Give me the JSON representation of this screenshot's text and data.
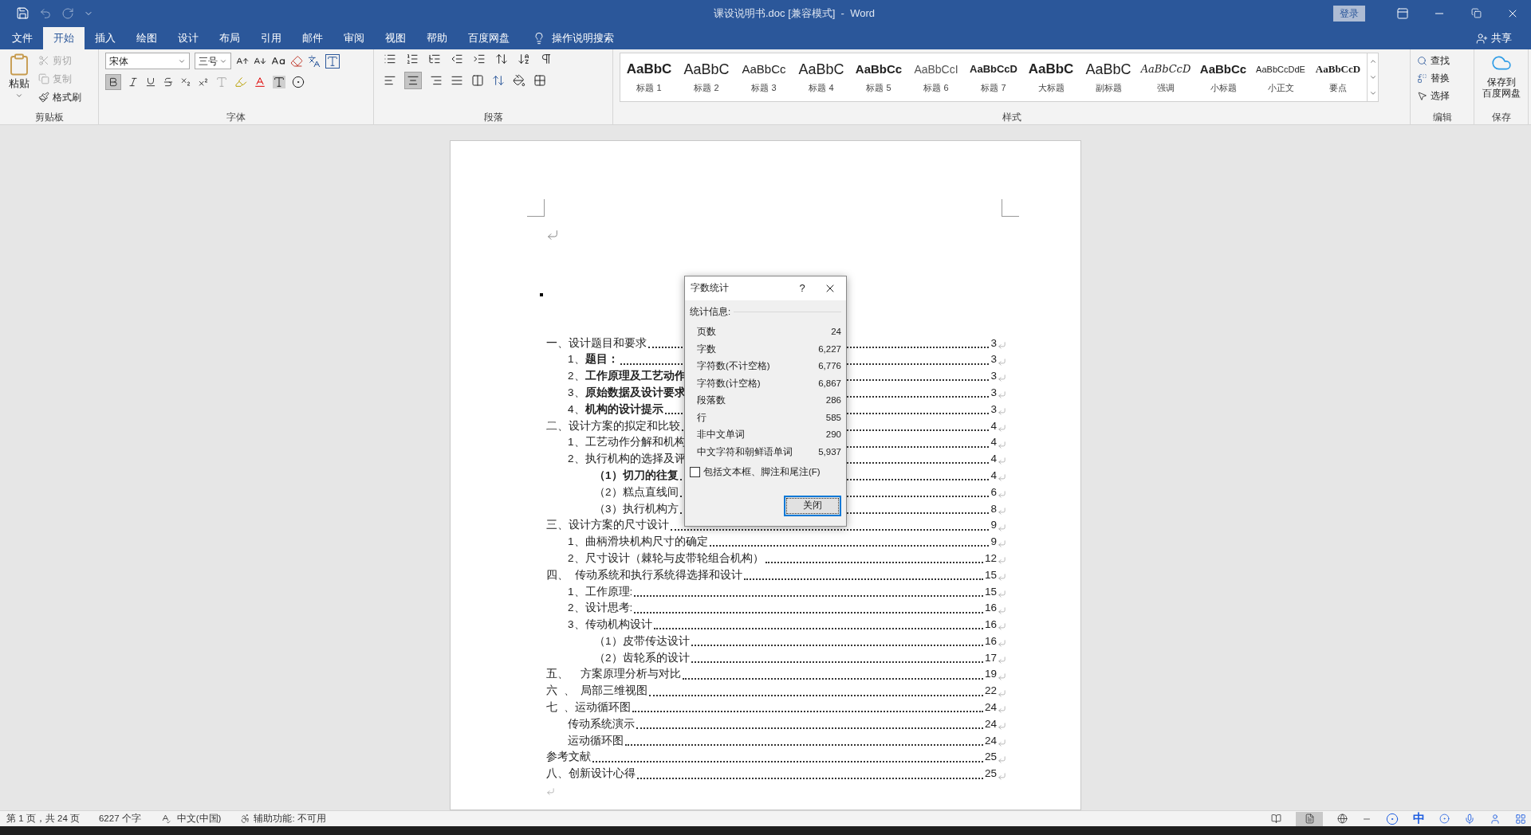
{
  "window": {
    "title": "课设说明书.doc [兼容模式]  -  Word",
    "sign_in": "登录"
  },
  "tabs": [
    {
      "label": "文件",
      "selected": false
    },
    {
      "label": "开始",
      "selected": true
    },
    {
      "label": "插入",
      "selected": false
    },
    {
      "label": "绘图",
      "selected": false
    },
    {
      "label": "设计",
      "selected": false
    },
    {
      "label": "布局",
      "selected": false
    },
    {
      "label": "引用",
      "selected": false
    },
    {
      "label": "邮件",
      "selected": false
    },
    {
      "label": "审阅",
      "selected": false
    },
    {
      "label": "视图",
      "selected": false
    },
    {
      "label": "帮助",
      "selected": false
    },
    {
      "label": "百度网盘",
      "selected": false
    }
  ],
  "tell_me": "操作说明搜索",
  "share": "共享",
  "clipboard": {
    "label": "剪贴板",
    "paste": "粘贴",
    "cut": {
      "label": "剪切",
      "disabled": true
    },
    "copy": {
      "label": "复制",
      "disabled": true
    },
    "format_painter": {
      "label": "格式刷",
      "disabled": false
    }
  },
  "font": {
    "label": "字体",
    "name": "宋体",
    "size": "三号",
    "bold": true
  },
  "paragraph": {
    "label": "段落",
    "align_center": true
  },
  "styles": {
    "label": "样式",
    "items": [
      {
        "preview": "AaBbC",
        "label": "标题 1",
        "kind": "heavy"
      },
      {
        "preview": "AaBbC",
        "label": "标题 2",
        "kind": "large"
      },
      {
        "preview": "AaBbCc",
        "label": "标题 3",
        "kind": "normal"
      },
      {
        "preview": "AaBbC",
        "label": "标题 4",
        "kind": "large"
      },
      {
        "preview": "AaBbCc",
        "label": "标题 5",
        "kind": "bold"
      },
      {
        "preview": "AaBbCcI",
        "label": "标题 6",
        "kind": "light"
      },
      {
        "preview": "AaBbCcD",
        "label": "标题 7",
        "kind": "bold-small"
      },
      {
        "preview": "AaBbC",
        "label": "大标题",
        "kind": "heavy"
      },
      {
        "preview": "AaBbC",
        "label": "副标题",
        "kind": "large"
      },
      {
        "preview": "AaBbCcD",
        "label": "强调",
        "kind": "italic"
      },
      {
        "preview": "AaBbCc",
        "label": "小标题",
        "kind": "bold"
      },
      {
        "preview": "AaBbCcDdE",
        "label": "小正文",
        "kind": "tiny"
      },
      {
        "preview": "AaBbCcD",
        "label": "要点",
        "kind": "serif-bold"
      }
    ]
  },
  "editing": {
    "label": "编辑",
    "find": "查找",
    "replace": "替换",
    "select": "选择"
  },
  "save": {
    "label": "保存",
    "button": [
      "保存到",
      "百度网盘"
    ]
  },
  "toc": [
    {
      "text": "一、设计题目和要求",
      "page": "3",
      "bold": false,
      "children": [
        {
          "text": "1、**题目：**",
          "page": "3",
          "bold": false
        },
        {
          "text": "2、**工作原理及工艺动作**",
          "page": "3",
          "bold": false
        },
        {
          "text": "3、**原始数据及设计要求**",
          "page": "3",
          "bold": false
        },
        {
          "text": "4、**机构的设计提示**",
          "page": "3",
          "bold": false
        }
      ]
    },
    {
      "text": "二、设计方案的拟定和比较",
      "page": "4",
      "bold": false,
      "children": [
        {
          "text": "1、工艺动作分解和机构",
          "page": "4",
          "bold": false
        },
        {
          "text": "2、执行机构的选择及评",
          "page": "4",
          "bold": false,
          "children": [
            {
              "text": "（1）切刀的往复",
              "page": "4",
              "bold": true
            },
            {
              "text": "（2）糕点直线间",
              "page": "6",
              "bold": false
            },
            {
              "text": "（3）执行机构方",
              "page": "8",
              "bold": false
            }
          ]
        }
      ]
    },
    {
      "text": "三、设计方案的尺寸设计",
      "page": "9",
      "bold": false,
      "children": [
        {
          "text": "1、曲柄滑块机构尺寸的确定",
          "page": "9",
          "bold": false
        },
        {
          "text": "2、尺寸设计（棘轮与皮带轮组合机构）",
          "page": "12",
          "bold": false
        }
      ]
    },
    {
      "text": "四、  传动系统和执行系统得选择和设计",
      "page": "15",
      "bold": false,
      "children": [
        {
          "text": "1、工作原理:",
          "page": "15",
          "bold": false
        },
        {
          "text": "2、设计思考:",
          "page": "16",
          "bold": false
        },
        {
          "text": "3、传动机构设计",
          "page": "16",
          "bold": false,
          "children": [
            {
              "text": "（1）皮带传达设计",
              "page": "16",
              "bold": false
            },
            {
              "text": "（2）齿轮系的设计",
              "page": "17",
              "bold": false
            }
          ]
        }
      ]
    },
    {
      "text": "五、    方案原理分析与对比",
      "page": "19",
      "bold": false
    },
    {
      "text": "六  、  局部三维视图",
      "page": "22",
      "bold": false
    },
    {
      "text": "七  、运动循环图",
      "page": "24",
      "bold": false,
      "children": [
        {
          "text": "传动系统演示",
          "page": "24",
          "bold": false
        },
        {
          "text": "运动循环图",
          "page": "24",
          "bold": false
        }
      ]
    },
    {
      "text": "参考文献",
      "page": "25",
      "bold": false
    },
    {
      "text": "八、创新设计心得",
      "page": "25",
      "bold": false
    }
  ],
  "dialog": {
    "title": "字数统计",
    "help": "?",
    "section": "统计信息:",
    "stats": [
      {
        "label": "页数",
        "value": "24"
      },
      {
        "label": "字数",
        "value": "6,227"
      },
      {
        "label": "字符数(不计空格)",
        "value": "6,776"
      },
      {
        "label": "字符数(计空格)",
        "value": "6,867"
      },
      {
        "label": "段落数",
        "value": "286"
      },
      {
        "label": "行",
        "value": "585"
      },
      {
        "label": "非中文单词",
        "value": "290"
      },
      {
        "label": "中文字符和朝鲜语单词",
        "value": "5,937"
      }
    ],
    "include": {
      "label": "包括文本框、脚注和尾注(F)",
      "checked": false
    },
    "close": "关闭"
  },
  "status_bar": {
    "page": "第 1 页，共 24 页",
    "words": "6227 个字",
    "language": "中文(中国)",
    "accessibility": "辅助功能: 不可用",
    "ime": "中"
  }
}
